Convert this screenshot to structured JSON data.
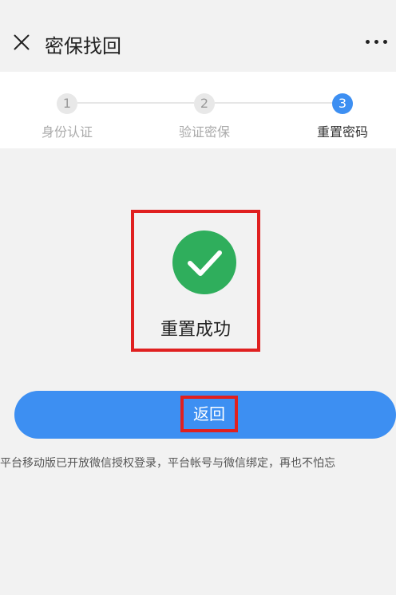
{
  "nav": {
    "title": "密保找回",
    "close_icon": "close-icon",
    "more_icon": "more-dots-icon"
  },
  "steps": [
    {
      "number": "1",
      "label": "身份认证",
      "active": false
    },
    {
      "number": "2",
      "label": "验证密保",
      "active": false
    },
    {
      "number": "3",
      "label": "重置密码",
      "active": true
    }
  ],
  "result": {
    "icon": "check-circle-icon",
    "message": "重置成功"
  },
  "actions": {
    "back_label": "返回"
  },
  "notice": "平台移动版已开放微信授权登录，平台帐号与微信绑定，再也不怕忘",
  "colors": {
    "accent": "#3d8ff2",
    "success": "#2fae5c",
    "highlight": "#e02020"
  }
}
